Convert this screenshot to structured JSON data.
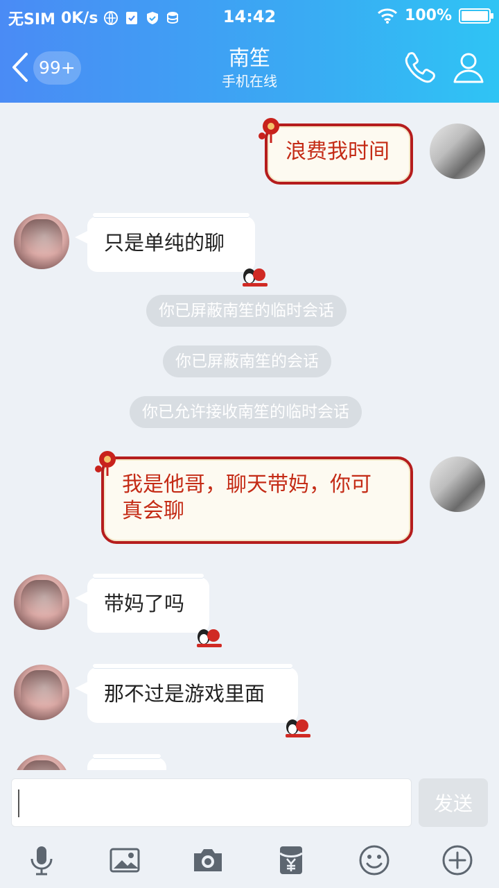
{
  "status_bar": {
    "carrier": "无SIM",
    "speed": "0K/s",
    "time": "14:42",
    "battery": "100%",
    "battery_level": 1.0
  },
  "header": {
    "unread_count": "99+",
    "contact_name": "南笙",
    "contact_status": "手机在线"
  },
  "messages": {
    "m1": "浪费我时间",
    "m2": "只是单纯的聊",
    "sys1": "你已屏蔽南笙的临时会话",
    "sys2": "你已屏蔽南笙的会话",
    "sys3": "你已允许接收南笙的临时会话",
    "m3_line1": "我是他哥，聊天带妈，你可",
    "m3_line2": "真会聊",
    "m4": "带妈了吗",
    "m5": "那不过是游戏里面",
    "m6": "…"
  },
  "composer": {
    "value": "",
    "send_label": "发送"
  },
  "colors": {
    "header_start": "#4a8bf5",
    "header_end": "#2fc4f4",
    "self_bubble_border": "#b51d1d",
    "self_bubble_text": "#c42b16"
  },
  "icons": {
    "toolbar": [
      "microphone-icon",
      "image-icon",
      "camera-icon",
      "red-packet-icon",
      "emoji-icon",
      "plus-icon"
    ]
  }
}
